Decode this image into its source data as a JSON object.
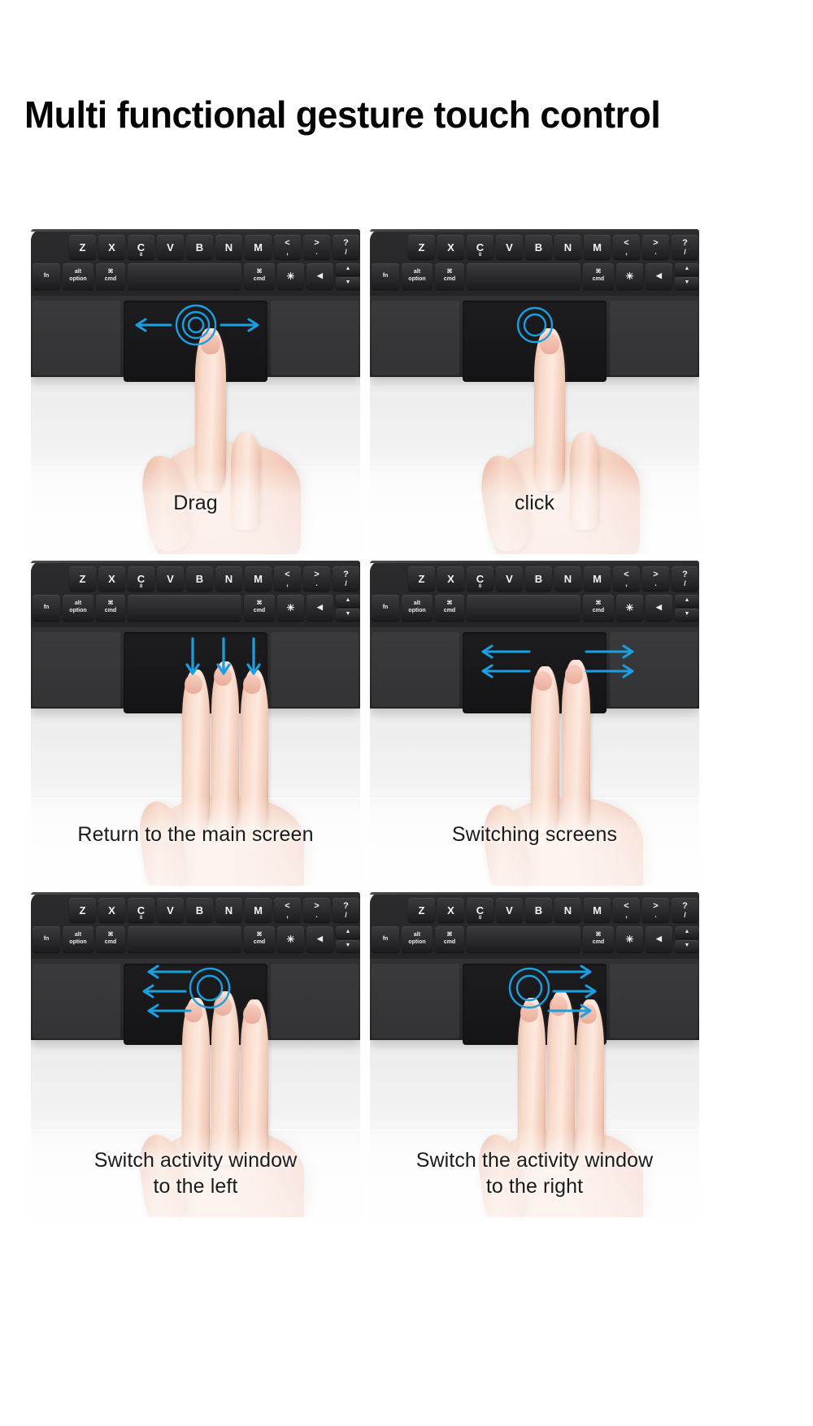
{
  "header": {
    "title": "Multi functional gesture touch control"
  },
  "keyboard": {
    "letter_keys": [
      "Z",
      "X",
      "C",
      "V",
      "B",
      "N",
      "M"
    ],
    "c_key_sub": "8",
    "punct_keys": [
      {
        "upper": "<",
        "lower": ","
      },
      {
        "upper": ">",
        "lower": "."
      },
      {
        "upper": "?",
        "lower": "/"
      }
    ],
    "modifier_keys": [
      {
        "top": "",
        "bottom": "fn"
      },
      {
        "top": "alt",
        "bottom": "option"
      },
      {
        "top": "⌘",
        "bottom": "cmd"
      },
      {
        "top": "",
        "bottom": ""
      },
      {
        "top": "⌘",
        "bottom": "cmd"
      },
      {
        "top": "☀",
        "bottom": ""
      },
      {
        "top": "◀",
        "bottom": ""
      }
    ],
    "arrow_up": "▲",
    "arrow_down": "▼"
  },
  "colors": {
    "accent": "#1a9fe0",
    "page_background": "#ffffff",
    "card_background": "#f4f4f5",
    "keyboard_dark": "#252527",
    "title_text": "#050505",
    "caption_text": "#1b1b1b"
  },
  "cards": [
    {
      "id": "drag",
      "caption": "Drag",
      "caption_line2": "",
      "gesture": "one-finger-horizontal-drag",
      "fingers": 1,
      "arrows": [
        "left",
        "right"
      ],
      "ripple": true
    },
    {
      "id": "click",
      "caption": "click",
      "caption_line2": "",
      "gesture": "one-finger-tap",
      "fingers": 1,
      "arrows": [],
      "ripple": true
    },
    {
      "id": "return-main-screen",
      "caption": "Return to the main screen",
      "caption_line2": "",
      "gesture": "three-finger-swipe-down",
      "fingers": 3,
      "arrows": [
        "down",
        "down",
        "down"
      ],
      "ripple": false
    },
    {
      "id": "switching-screens",
      "caption": "Switching screens",
      "caption_line2": "",
      "gesture": "two-finger-swipe-horizontal",
      "fingers": 2,
      "arrows": [
        "left",
        "right",
        "left",
        "right"
      ],
      "ripple": false
    },
    {
      "id": "switch-activity-window-left",
      "caption": "Switch activity window",
      "caption_line2": "to the left",
      "gesture": "three-finger-swipe-left",
      "fingers": 3,
      "arrows": [
        "left",
        "left",
        "left"
      ],
      "ripple": true
    },
    {
      "id": "switch-activity-window-right",
      "caption": "Switch the activity window",
      "caption_line2": "to the right",
      "gesture": "three-finger-swipe-right",
      "fingers": 3,
      "arrows": [
        "right",
        "right",
        "right"
      ],
      "ripple": true
    }
  ]
}
